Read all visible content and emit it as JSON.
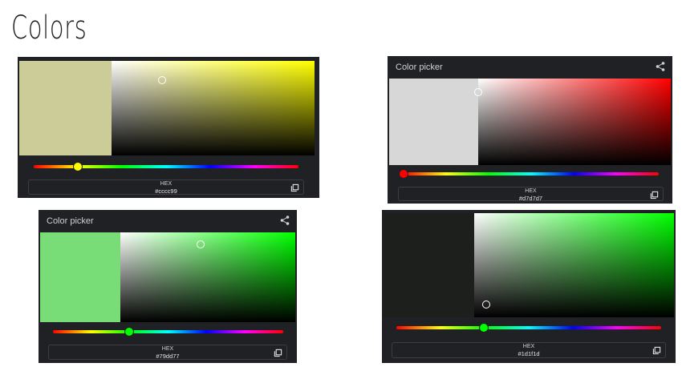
{
  "page": {
    "title": "Colors"
  },
  "pickers": [
    {
      "header": "",
      "swatch_color": "#cccc99",
      "hue_color": "#ffff00",
      "hue_thumb_color": "#ffff00",
      "hue_position": 0.166,
      "saturation": 0.25,
      "value": 0.8,
      "hex_label": "HEX",
      "hex_value": "#cccc99"
    },
    {
      "header": "Color picker",
      "swatch_color": "#d7d7d7",
      "hue_color": "#ff0000",
      "hue_thumb_color": "#ff0000",
      "hue_position": 0.0,
      "saturation": 0.0,
      "value": 0.84,
      "hex_label": "HEX",
      "hex_value": "#d7d7d7"
    },
    {
      "header": "Color picker",
      "swatch_color": "#79dd77",
      "hue_color": "#00ff00",
      "hue_thumb_color": "#00ff00",
      "hue_position": 0.33,
      "saturation": 0.46,
      "value": 0.87,
      "hex_label": "HEX",
      "hex_value": "#79dd77"
    },
    {
      "header": "",
      "swatch_color": "#1d1f1d",
      "hue_color": "#00ff00",
      "hue_thumb_color": "#00ff00",
      "hue_position": 0.33,
      "saturation": 0.06,
      "value": 0.12,
      "hex_label": "HEX",
      "hex_value": "#1d1f1d"
    }
  ],
  "icons": {
    "share": "share-icon",
    "copy": "copy-icon"
  }
}
